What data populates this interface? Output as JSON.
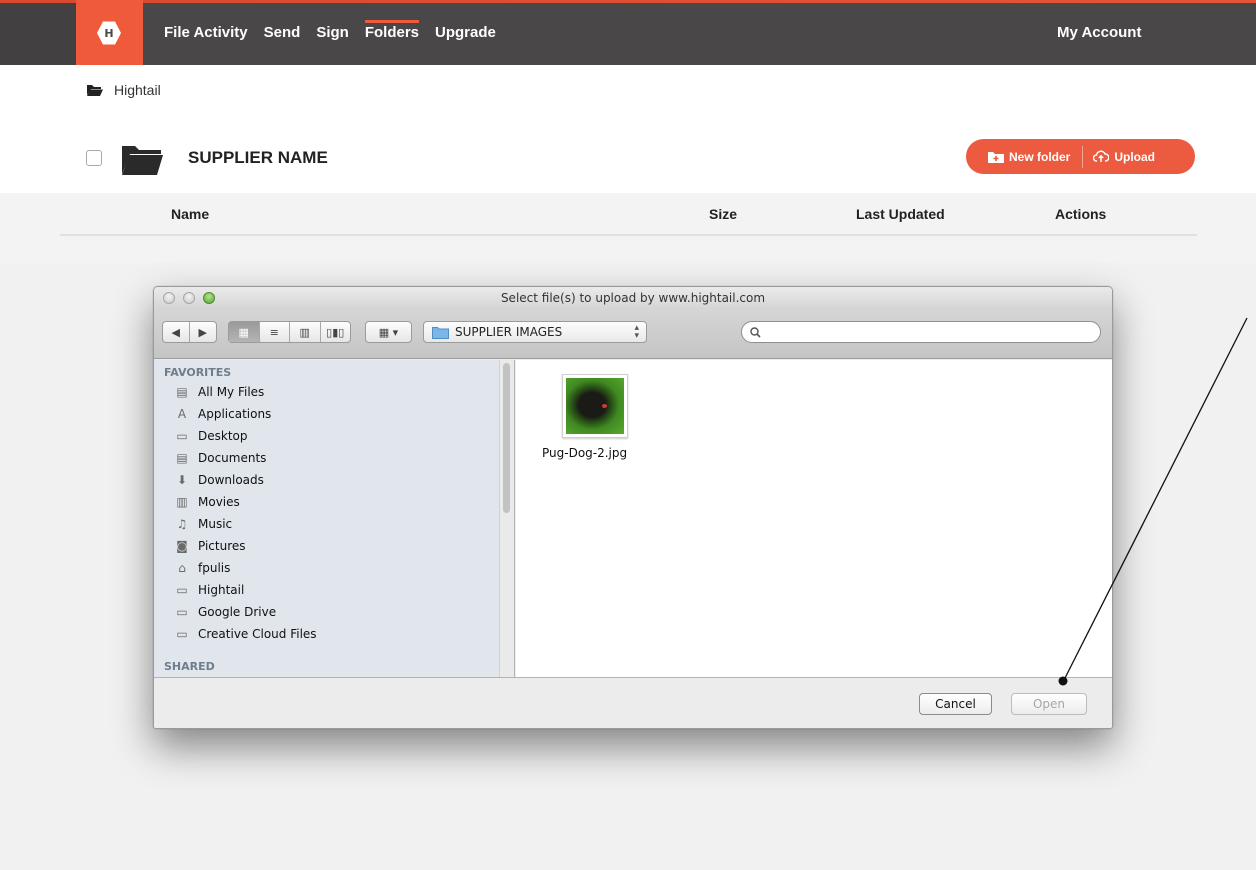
{
  "nav": {
    "logo_letter": "H",
    "items": [
      {
        "label": "File Activity",
        "active": false
      },
      {
        "label": "Send",
        "active": false
      },
      {
        "label": "Sign",
        "active": false
      },
      {
        "label": "Folders",
        "active": true
      },
      {
        "label": "Upgrade",
        "active": false
      }
    ],
    "account_label": "My Account",
    "accent_color": "#ee5a3a",
    "bar_color": "#4a4749"
  },
  "breadcrumb": {
    "label": "Hightail",
    "icon": "folder-open-icon"
  },
  "folder": {
    "title": "SUPPLIER NAME",
    "icon": "folder-icon"
  },
  "actions": {
    "new_folder_label": "New folder",
    "upload_label": "Upload",
    "color": "#ec5a3f"
  },
  "table": {
    "headers": [
      "Name",
      "Size",
      "Last Updated",
      "Actions"
    ]
  },
  "dialog": {
    "title": "Select file(s) to upload by www.hightail.com",
    "location": "SUPPLIER IMAGES",
    "search_placeholder": "",
    "view_modes": [
      "icon-view-icon",
      "list-view-icon",
      "column-view-icon",
      "coverflow-view-icon"
    ],
    "sidebar": {
      "sections": [
        {
          "heading": "FAVORITES",
          "items": [
            {
              "label": "All My Files",
              "icon": "all-files-icon"
            },
            {
              "label": "Applications",
              "icon": "applications-icon"
            },
            {
              "label": "Desktop",
              "icon": "desktop-icon"
            },
            {
              "label": "Documents",
              "icon": "documents-icon"
            },
            {
              "label": "Downloads",
              "icon": "downloads-icon"
            },
            {
              "label": "Movies",
              "icon": "movies-icon"
            },
            {
              "label": "Music",
              "icon": "music-icon"
            },
            {
              "label": "Pictures",
              "icon": "pictures-icon"
            },
            {
              "label": "fpulis",
              "icon": "home-icon"
            },
            {
              "label": "Hightail",
              "icon": "folder-icon"
            },
            {
              "label": "Google Drive",
              "icon": "folder-icon"
            },
            {
              "label": "Creative Cloud Files",
              "icon": "folder-icon"
            }
          ]
        },
        {
          "heading": "SHARED",
          "items": []
        }
      ]
    },
    "files": [
      {
        "name": "Pug-Dog-2.jpg",
        "kind": "image"
      }
    ],
    "buttons": {
      "cancel": "Cancel",
      "open": "Open",
      "open_enabled": false
    }
  }
}
